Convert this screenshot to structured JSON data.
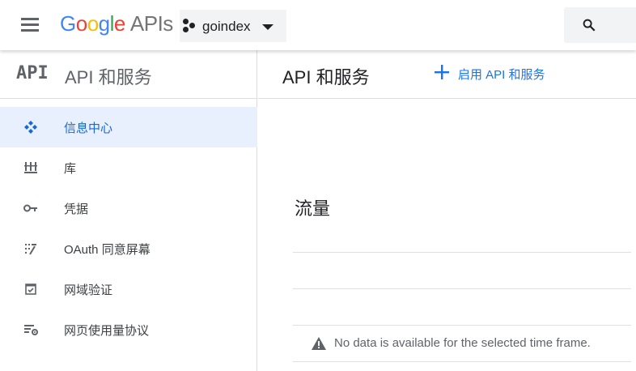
{
  "header": {
    "logo_google": [
      "G",
      "o",
      "o",
      "g",
      "l",
      "e"
    ],
    "logo_apis": "APIs",
    "project_name": "goindex"
  },
  "sidebar": {
    "api_logo": "API",
    "title": "API 和服务",
    "items": [
      {
        "label": "信息中心",
        "icon": "dashboard-icon",
        "active": true
      },
      {
        "label": "库",
        "icon": "library-icon",
        "active": false
      },
      {
        "label": "凭据",
        "icon": "key-icon",
        "active": false
      },
      {
        "label": "OAuth 同意屏幕",
        "icon": "consent-screen-icon",
        "active": false
      },
      {
        "label": "网域验证",
        "icon": "domain-verification-icon",
        "active": false
      },
      {
        "label": "网页使用量协议",
        "icon": "usage-agreement-icon",
        "active": false
      }
    ]
  },
  "main": {
    "title": "API 和服务",
    "enable_button_label": "启用 API 和服务",
    "traffic_title": "流量",
    "no_data_message": "No data is available for the selected time frame."
  },
  "colors": {
    "accent": "#1a73e8",
    "active_bg": "#e8f0fe",
    "icon_gray": "#5f6368"
  }
}
